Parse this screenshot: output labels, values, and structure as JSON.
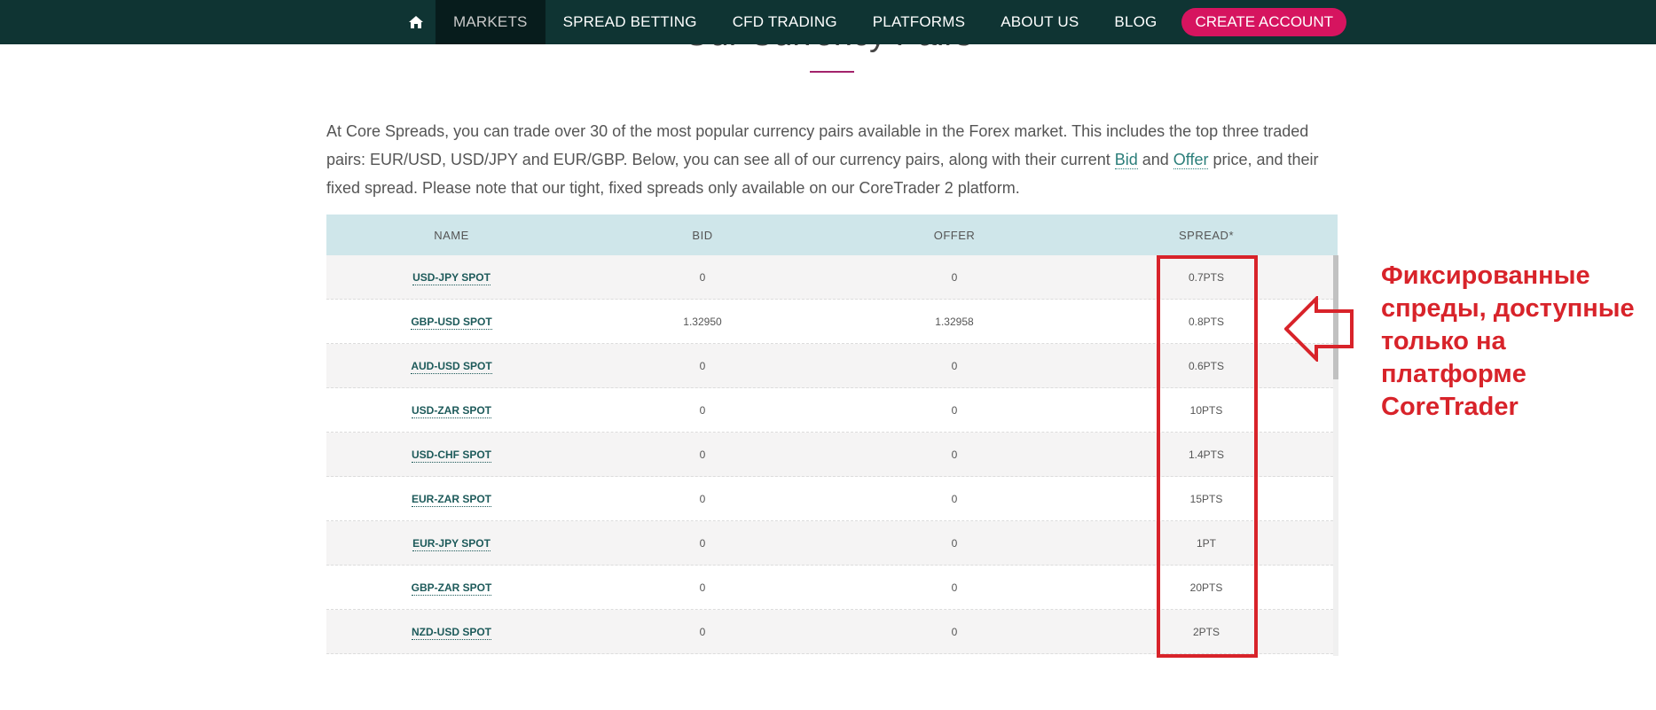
{
  "nav": {
    "home_icon": "home-icon",
    "items": [
      "MARKETS",
      "SPREAD BETTING",
      "CFD TRADING",
      "PLATFORMS",
      "ABOUT US",
      "BLOG"
    ],
    "cta": "CREATE ACCOUNT"
  },
  "section": {
    "title": "Our Currency Pairs"
  },
  "intro": {
    "part1": "At Core Spreads, you can trade over 30 of the most popular currency pairs available in the Forex market. This includes the top three traded pairs: EUR/USD, USD/JPY and EUR/GBP. Below, you can see all of our currency pairs, along with their current ",
    "bid_link": "Bid",
    "part2": " and ",
    "offer_link": "Offer",
    "part3": " price, and their fixed spread. Please note that our tight, fixed spreads only available on our CoreTrader 2 platform."
  },
  "table": {
    "headers": [
      "NAME",
      "BID",
      "OFFER",
      "SPREAD*"
    ],
    "rows": [
      {
        "name": "USD-JPY SPOT",
        "bid": "0",
        "offer": "0",
        "spread": "0.7PTS"
      },
      {
        "name": "GBP-USD SPOT",
        "bid": "1.32950",
        "offer": "1.32958",
        "spread": "0.8PTS"
      },
      {
        "name": "AUD-USD SPOT",
        "bid": "0",
        "offer": "0",
        "spread": "0.6PTS"
      },
      {
        "name": "USD-ZAR SPOT",
        "bid": "0",
        "offer": "0",
        "spread": "10PTS"
      },
      {
        "name": "USD-CHF SPOT",
        "bid": "0",
        "offer": "0",
        "spread": "1.4PTS"
      },
      {
        "name": "EUR-ZAR SPOT",
        "bid": "0",
        "offer": "0",
        "spread": "15PTS"
      },
      {
        "name": "EUR-JPY SPOT",
        "bid": "0",
        "offer": "0",
        "spread": "1PT"
      },
      {
        "name": "GBP-ZAR SPOT",
        "bid": "0",
        "offer": "0",
        "spread": "20PTS"
      },
      {
        "name": "NZD-USD SPOT",
        "bid": "0",
        "offer": "0",
        "spread": "2PTS"
      }
    ]
  },
  "annotation": {
    "lines": [
      "Фиксированные",
      "спреды, доступные",
      "только на",
      "платформе",
      "CoreTrader"
    ],
    "color": "#d8232a"
  },
  "colors": {
    "nav_bg": "#0f3433",
    "cta_bg": "#d6145f",
    "table_header_bg": "#cfe6ea",
    "link": "#2b7e7a"
  }
}
